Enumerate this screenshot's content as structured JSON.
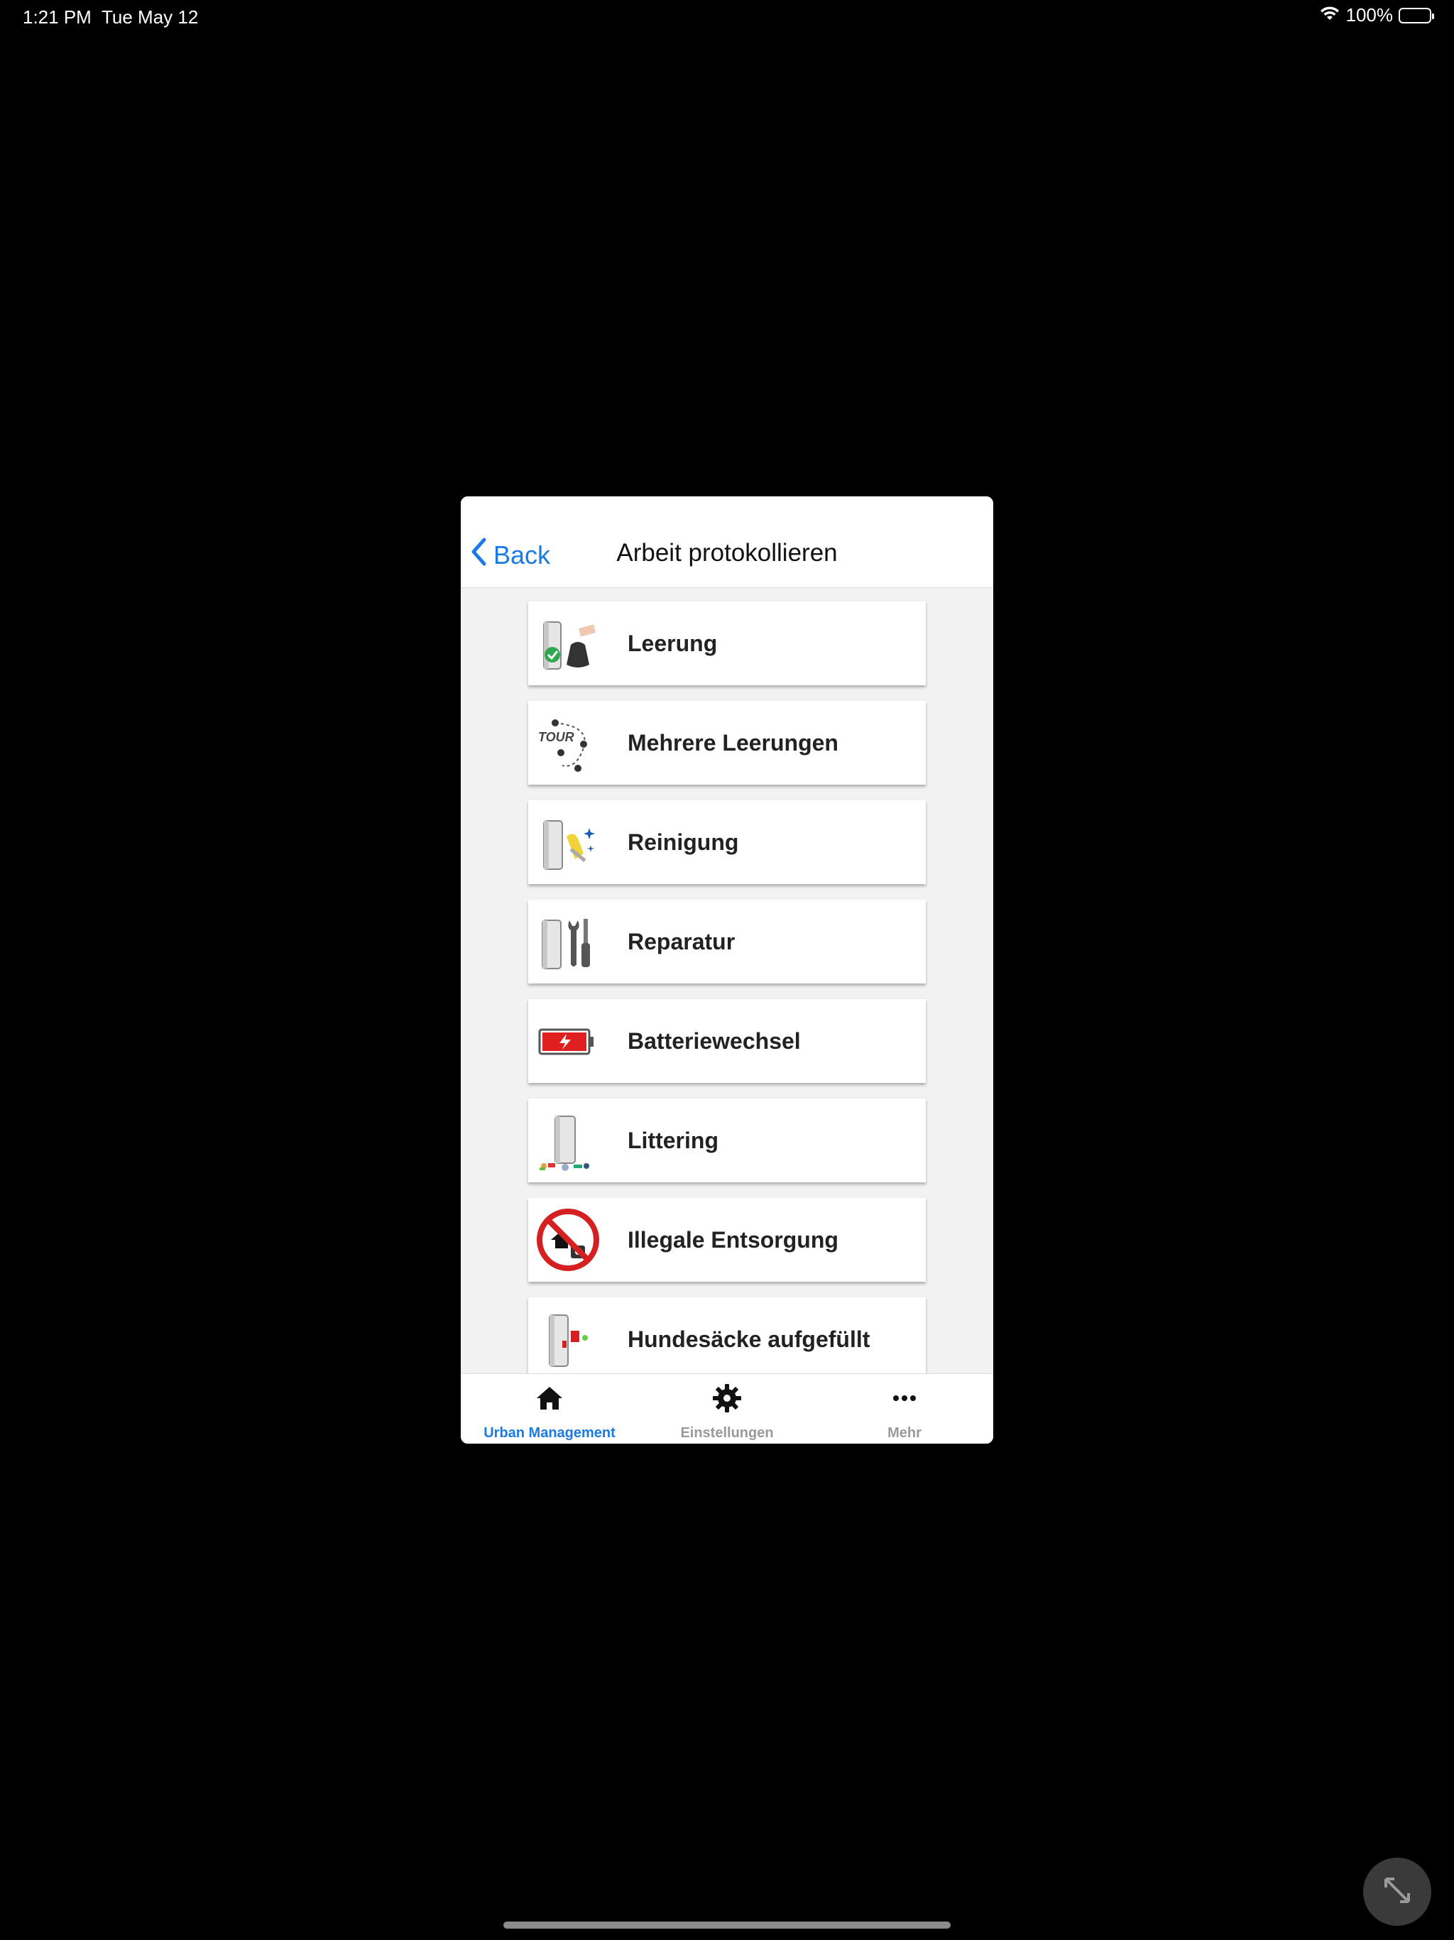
{
  "status": {
    "time": "1:21 PM",
    "date": "Tue May 12",
    "battery": "100%",
    "icons": [
      "wifi-icon",
      "battery-icon"
    ]
  },
  "nav": {
    "back_label": "Back",
    "title": "Arbeit protokollieren"
  },
  "items": [
    {
      "label": "Leerung",
      "icon": "bin-emptied-icon"
    },
    {
      "label": "Mehrere Leerungen",
      "icon": "tour-icon",
      "icon_text": "TOUR"
    },
    {
      "label": "Reinigung",
      "icon": "cleaning-icon"
    },
    {
      "label": "Reparatur",
      "icon": "repair-icon"
    },
    {
      "label": "Batteriewechsel",
      "icon": "battery-change-icon"
    },
    {
      "label": "Littering",
      "icon": "littering-icon"
    },
    {
      "label": "Illegale Entsorgung",
      "icon": "illegal-dumping-icon"
    },
    {
      "label": "Hundesäcke aufgefüllt",
      "icon": "dog-bags-icon"
    }
  ],
  "tabs": [
    {
      "label": "Urban Management",
      "icon": "home-icon",
      "active": true
    },
    {
      "label": "Einstellungen",
      "icon": "gear-icon",
      "active": false
    },
    {
      "label": "Mehr",
      "icon": "more-icon",
      "active": false
    }
  ],
  "colors": {
    "accent": "#1a7be5",
    "background": "#000000",
    "list_bg": "#f2f2f2"
  }
}
